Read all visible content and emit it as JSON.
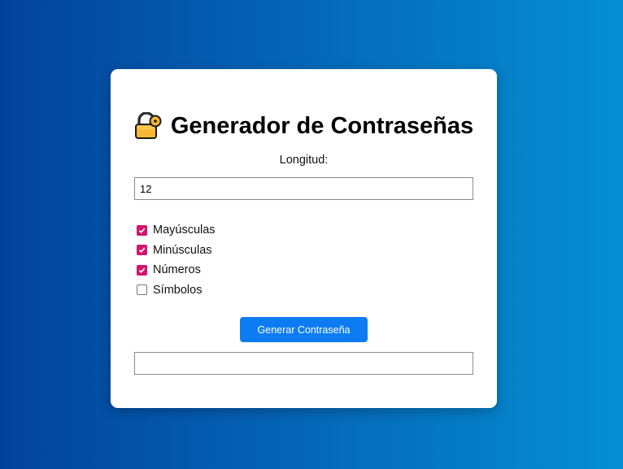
{
  "header": {
    "title": "Generador de Contraseñas",
    "icon": "lock-icon"
  },
  "length": {
    "label": "Longitud:",
    "value": "12"
  },
  "options": [
    {
      "label": "Mayúsculas",
      "checked": true
    },
    {
      "label": "Minúsculas",
      "checked": true
    },
    {
      "label": "Números",
      "checked": true
    },
    {
      "label": "Símbolos",
      "checked": false
    }
  ],
  "generate_button": {
    "label": "Generar Contraseña"
  },
  "output": {
    "value": ""
  },
  "colors": {
    "accent_button": "#0d7cf2",
    "checkbox_checked": "#d3156e",
    "background_left": "#03429b",
    "background_right": "#058fd3"
  }
}
